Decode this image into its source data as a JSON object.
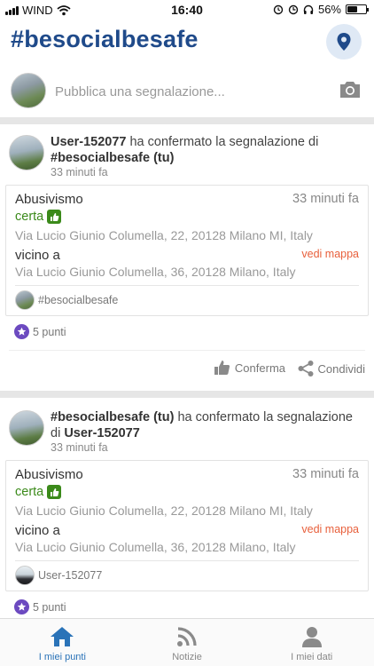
{
  "status_bar": {
    "carrier": "WIND",
    "time": "16:40",
    "battery": "56%",
    "battery_level": 0.56
  },
  "header": {
    "title": "#besocialbesafe",
    "map_icon": "location-pin-icon"
  },
  "composer": {
    "placeholder": "Pubblica una segnalazione...",
    "camera_icon": "camera-icon"
  },
  "feed": [
    {
      "actor": "User-152077",
      "action": " ha confermato la segnalazione di ",
      "target": "#besocialbesafe (tu)",
      "time": "33 minuti fa",
      "report": {
        "type": "Abusivismo",
        "time": "33 minuti fa",
        "status": "certa",
        "address": "Via Lucio Giunio Columella, 22, 20128 Milano MI, Italy",
        "near_label": "vicino a",
        "map_link": "vedi mappa",
        "near_address": "Via Lucio Giunio Columella, 36, 20128 Milano, Italy",
        "author": "#besocialbesafe"
      },
      "points": "5 punti",
      "confirm_label": "Conferma",
      "share_label": "Condividi"
    },
    {
      "actor": "#besocialbesafe (tu)",
      "action": " ha confermato la segnalazione di ",
      "target": "User-152077",
      "time": "33 minuti fa",
      "report": {
        "type": "Abusivismo",
        "time": "33 minuti fa",
        "status": "certa",
        "address": "Via Lucio Giunio Columella, 22, 20128 Milano MI, Italy",
        "near_label": "vicino a",
        "map_link": "vedi mappa",
        "near_address": "Via Lucio Giunio Columella, 36, 20128 Milano, Italy",
        "author": "User-152077"
      },
      "points": "5 punti"
    }
  ],
  "tabbar": {
    "tabs": [
      {
        "label": "I miei punti",
        "icon": "home-icon",
        "active": true
      },
      {
        "label": "Notizie",
        "icon": "rss-icon",
        "active": false
      },
      {
        "label": "I miei dati",
        "icon": "user-icon",
        "active": false
      }
    ]
  },
  "colors": {
    "brand": "#1f4a8a",
    "status_ok": "#3b8a1a",
    "link": "#e8603c",
    "points": "#6c4ac0",
    "tab_active": "#2a73b8"
  }
}
